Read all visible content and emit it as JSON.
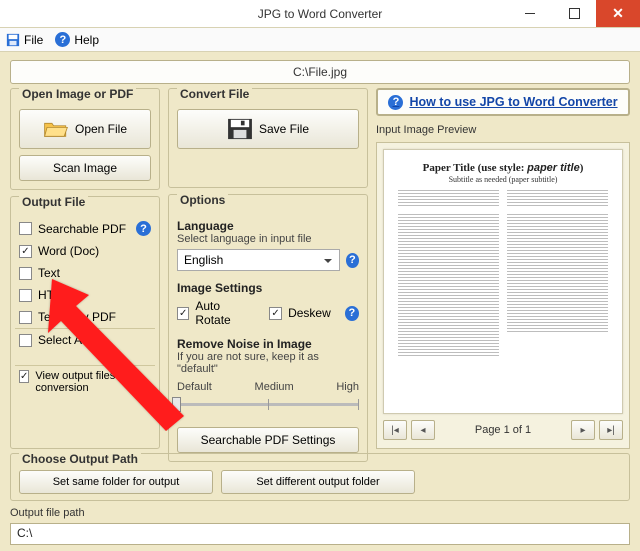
{
  "window": {
    "title": "JPG to Word Converter"
  },
  "menu": {
    "file": "File",
    "help": "Help"
  },
  "path": "C:\\File.jpg",
  "open_group": {
    "legend": "Open Image or PDF",
    "open_btn": "Open File",
    "scan_btn": "Scan Image"
  },
  "convert_group": {
    "legend": "Convert File",
    "save_btn": "Save File"
  },
  "howto": "How to use JPG to Word Converter",
  "output_group": {
    "legend": "Output File",
    "items": {
      "pdf": {
        "label": "Searchable PDF",
        "checked": false
      },
      "word": {
        "label": "Word (Doc)",
        "checked": true
      },
      "text": {
        "label": "Text",
        "checked": false
      },
      "html": {
        "label": "HTML",
        "checked": false
      },
      "txtpdf": {
        "label": "Text-Only PDF",
        "checked": false
      }
    },
    "select_all": {
      "label": "Select All",
      "checked": false
    },
    "view_after": {
      "label": "View output files after conversion",
      "checked": true
    }
  },
  "options_group": {
    "legend": "Options",
    "language_head": "Language",
    "language_note": "Select language in input file",
    "language_value": "English",
    "image_head": "Image Settings",
    "auto_rotate": {
      "label": "Auto Rotate",
      "checked": true
    },
    "deskew": {
      "label": "Deskew",
      "checked": true
    },
    "noise_head": "Remove Noise in Image",
    "noise_note": "If you are not sure, keep it as \"default\"",
    "noise_levels": {
      "lo": "Default",
      "mid": "Medium",
      "hi": "High"
    },
    "searchable_btn": "Searchable PDF Settings"
  },
  "choose_path": {
    "legend": "Choose Output Path",
    "same": "Set same folder for output",
    "diff": "Set different output folder"
  },
  "preview": {
    "label": "Input Image Preview",
    "title": "Paper Title (use style: paper title)",
    "subtitle": "Subtitle as needed (paper subtitle)",
    "pager": "Page 1 of 1"
  },
  "outpath": {
    "label": "Output file path",
    "value": "C:\\"
  }
}
